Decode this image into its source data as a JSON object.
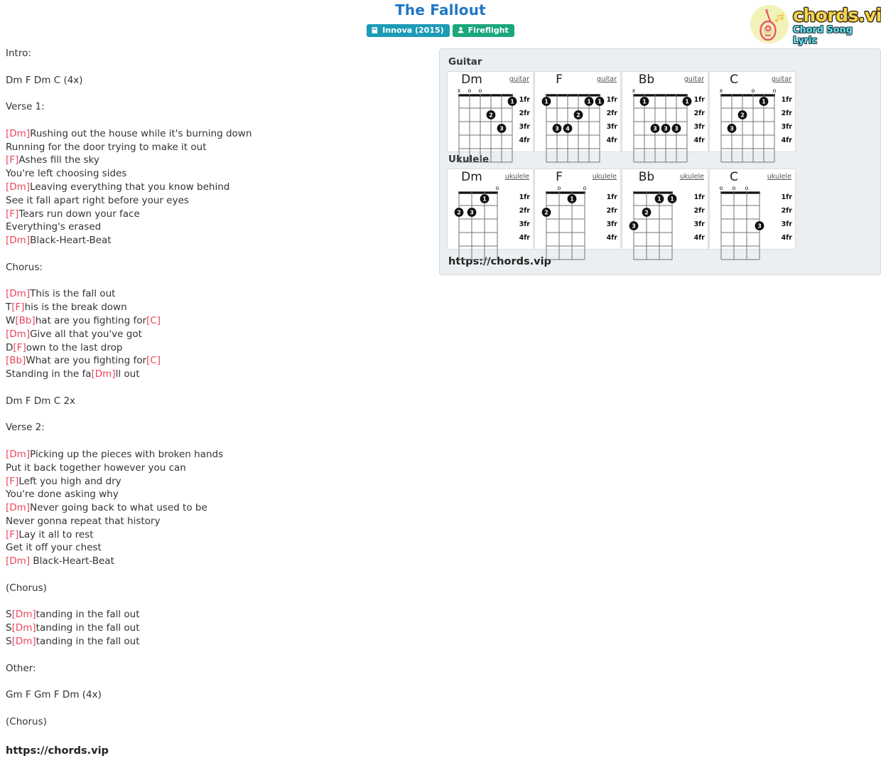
{
  "header": {
    "title": "The Fallout",
    "badges": [
      {
        "icon": "album-icon",
        "label": "Innova (2015)",
        "color": "#1b9bb5"
      },
      {
        "icon": "artist-icon",
        "label": "Fireflight",
        "color": "#1aa77b"
      }
    ]
  },
  "logo": {
    "main": "chords.vip",
    "sub": "Chord Song Lyric",
    "icon": "guitar-icon",
    "colors": {
      "circle": "#f2f2b8",
      "guitar": "#e8546a",
      "main": "#f7d34a",
      "sub": "#63e6f0"
    }
  },
  "lyrics": {
    "accent_color": "#e8475c",
    "blocks": [
      {
        "type": "text",
        "segments": [
          {
            "t": "Intro:"
          }
        ]
      },
      {
        "type": "blank"
      },
      {
        "type": "text",
        "segments": [
          {
            "t": "Dm F Dm C (4x)"
          }
        ]
      },
      {
        "type": "blank"
      },
      {
        "type": "text",
        "segments": [
          {
            "t": "Verse 1:"
          }
        ]
      },
      {
        "type": "blank"
      },
      {
        "type": "text",
        "segments": [
          {
            "c": "[Dm]"
          },
          {
            "t": "Rushing out the house while it's burning down"
          }
        ]
      },
      {
        "type": "text",
        "segments": [
          {
            "t": "Running for the door trying to make it out"
          }
        ]
      },
      {
        "type": "text",
        "segments": [
          {
            "c": "[F]"
          },
          {
            "t": "Ashes fill the sky"
          }
        ]
      },
      {
        "type": "text",
        "segments": [
          {
            "t": "You're left choosing sides"
          }
        ]
      },
      {
        "type": "text",
        "segments": [
          {
            "c": "[Dm]"
          },
          {
            "t": "Leaving everything that you know behind"
          }
        ]
      },
      {
        "type": "text",
        "segments": [
          {
            "t": "See it fall apart right before your eyes"
          }
        ]
      },
      {
        "type": "text",
        "segments": [
          {
            "c": "[F]"
          },
          {
            "t": "Tears run down your face"
          }
        ]
      },
      {
        "type": "text",
        "segments": [
          {
            "t": "Everything's erased"
          }
        ]
      },
      {
        "type": "text",
        "segments": [
          {
            "c": "[Dm]"
          },
          {
            "t": "Black-Heart-Beat"
          }
        ]
      },
      {
        "type": "blank"
      },
      {
        "type": "text",
        "segments": [
          {
            "t": "Chorus:"
          }
        ]
      },
      {
        "type": "blank"
      },
      {
        "type": "text",
        "segments": [
          {
            "c": "[Dm]"
          },
          {
            "t": "This is the fall out"
          }
        ]
      },
      {
        "type": "text",
        "segments": [
          {
            "t": "T"
          },
          {
            "c": "[F]"
          },
          {
            "t": "his is the break down"
          }
        ]
      },
      {
        "type": "text",
        "segments": [
          {
            "t": "W"
          },
          {
            "c": "[Bb]"
          },
          {
            "t": "hat are you fighting for"
          },
          {
            "c": "[C]"
          }
        ]
      },
      {
        "type": "text",
        "segments": [
          {
            "c": "[Dm]"
          },
          {
            "t": "Give all that you've got"
          }
        ]
      },
      {
        "type": "text",
        "segments": [
          {
            "t": "D"
          },
          {
            "c": "[F]"
          },
          {
            "t": "own to the last drop"
          }
        ]
      },
      {
        "type": "text",
        "segments": [
          {
            "c": "[Bb]"
          },
          {
            "t": "What are you fighting for"
          },
          {
            "c": "[C]"
          }
        ]
      },
      {
        "type": "text",
        "segments": [
          {
            "t": "Standing in the fa"
          },
          {
            "c": "[Dm]"
          },
          {
            "t": "ll out"
          }
        ]
      },
      {
        "type": "blank"
      },
      {
        "type": "text",
        "segments": [
          {
            "t": "Dm F Dm C 2x"
          }
        ]
      },
      {
        "type": "blank"
      },
      {
        "type": "text",
        "segments": [
          {
            "t": "Verse 2:"
          }
        ]
      },
      {
        "type": "blank"
      },
      {
        "type": "text",
        "segments": [
          {
            "c": "[Dm]"
          },
          {
            "t": "Picking up the pieces with broken hands"
          }
        ]
      },
      {
        "type": "text",
        "segments": [
          {
            "t": "Put it back together however you can"
          }
        ]
      },
      {
        "type": "text",
        "segments": [
          {
            "c": "[F]"
          },
          {
            "t": "Left you high and dry"
          }
        ]
      },
      {
        "type": "text",
        "segments": [
          {
            "t": "You're done asking why"
          }
        ]
      },
      {
        "type": "text",
        "segments": [
          {
            "c": "[Dm]"
          },
          {
            "t": "Never going back to what used to be"
          }
        ]
      },
      {
        "type": "text",
        "segments": [
          {
            "t": "Never gonna repeat that history"
          }
        ]
      },
      {
        "type": "text",
        "segments": [
          {
            "c": "[F]"
          },
          {
            "t": "Lay it all to rest"
          }
        ]
      },
      {
        "type": "text",
        "segments": [
          {
            "t": "Get it off your chest"
          }
        ]
      },
      {
        "type": "text",
        "segments": [
          {
            "c": "[Dm]"
          },
          {
            "t": " Black-Heart-Beat"
          }
        ]
      },
      {
        "type": "blank"
      },
      {
        "type": "text",
        "segments": [
          {
            "t": "(Chorus)"
          }
        ]
      },
      {
        "type": "blank"
      },
      {
        "type": "text",
        "segments": [
          {
            "t": "S"
          },
          {
            "c": "[Dm]"
          },
          {
            "t": "tanding in the fall out"
          }
        ]
      },
      {
        "type": "text",
        "segments": [
          {
            "t": "S"
          },
          {
            "c": "[Dm]"
          },
          {
            "t": "tanding in the fall out"
          }
        ]
      },
      {
        "type": "text",
        "segments": [
          {
            "t": "S"
          },
          {
            "c": "[Dm]"
          },
          {
            "t": "tanding in the fall out"
          }
        ]
      },
      {
        "type": "blank"
      },
      {
        "type": "text",
        "segments": [
          {
            "t": "Other:"
          }
        ]
      },
      {
        "type": "blank"
      },
      {
        "type": "text",
        "segments": [
          {
            "t": "Gm F Gm F Dm (4x)"
          }
        ]
      },
      {
        "type": "blank"
      },
      {
        "type": "text",
        "segments": [
          {
            "t": "(Chorus)"
          }
        ]
      },
      {
        "type": "blank"
      },
      {
        "type": "url",
        "segments": [
          {
            "t": "https://chords.vip"
          }
        ]
      }
    ]
  },
  "panel": {
    "url": "https://chords.vip",
    "fret_labels": [
      "1fr",
      "2fr",
      "3fr",
      "4fr"
    ],
    "sections": [
      {
        "heading": "Guitar",
        "instrument_label": "guitar",
        "strings": 6,
        "chords": [
          {
            "name": "Dm",
            "markers": [
              {
                "string": 1,
                "sym": "x"
              },
              {
                "string": 2,
                "sym": "o"
              },
              {
                "string": 3,
                "sym": "o"
              }
            ],
            "dots": [
              {
                "string": 6,
                "fret": 1,
                "finger": "1"
              },
              {
                "string": 4,
                "fret": 2,
                "finger": "2"
              },
              {
                "string": 5,
                "fret": 3,
                "finger": "3"
              }
            ]
          },
          {
            "name": "F",
            "markers": [],
            "dots": [
              {
                "string": 1,
                "fret": 1,
                "finger": "1"
              },
              {
                "string": 5,
                "fret": 1,
                "finger": "1"
              },
              {
                "string": 6,
                "fret": 1,
                "finger": "1"
              },
              {
                "string": 4,
                "fret": 2,
                "finger": "2"
              },
              {
                "string": 2,
                "fret": 3,
                "finger": "3"
              },
              {
                "string": 3,
                "fret": 3,
                "finger": "4"
              }
            ]
          },
          {
            "name": "Bb",
            "markers": [
              {
                "string": 1,
                "sym": "x"
              }
            ],
            "dots": [
              {
                "string": 2,
                "fret": 1,
                "finger": "1"
              },
              {
                "string": 6,
                "fret": 1,
                "finger": "1"
              },
              {
                "string": 3,
                "fret": 3,
                "finger": "3"
              },
              {
                "string": 4,
                "fret": 3,
                "finger": "3"
              },
              {
                "string": 5,
                "fret": 3,
                "finger": "3"
              }
            ]
          },
          {
            "name": "C",
            "markers": [
              {
                "string": 1,
                "sym": "x"
              },
              {
                "string": 4,
                "sym": "o"
              },
              {
                "string": 6,
                "sym": "o"
              }
            ],
            "dots": [
              {
                "string": 5,
                "fret": 1,
                "finger": "1"
              },
              {
                "string": 3,
                "fret": 2,
                "finger": "2"
              },
              {
                "string": 2,
                "fret": 3,
                "finger": "3"
              }
            ]
          }
        ]
      },
      {
        "heading": "Ukulele",
        "instrument_label": "ukulele",
        "strings": 4,
        "chords": [
          {
            "name": "Dm",
            "markers": [
              {
                "string": 4,
                "sym": "o"
              }
            ],
            "dots": [
              {
                "string": 3,
                "fret": 1,
                "finger": "1"
              },
              {
                "string": 1,
                "fret": 2,
                "finger": "2"
              },
              {
                "string": 2,
                "fret": 2,
                "finger": "3"
              }
            ]
          },
          {
            "name": "F",
            "markers": [
              {
                "string": 2,
                "sym": "o"
              },
              {
                "string": 4,
                "sym": "o"
              }
            ],
            "dots": [
              {
                "string": 3,
                "fret": 1,
                "finger": "1"
              },
              {
                "string": 1,
                "fret": 2,
                "finger": "2"
              }
            ]
          },
          {
            "name": "Bb",
            "markers": [],
            "dots": [
              {
                "string": 3,
                "fret": 1,
                "finger": "1"
              },
              {
                "string": 4,
                "fret": 1,
                "finger": "1"
              },
              {
                "string": 2,
                "fret": 2,
                "finger": "2"
              },
              {
                "string": 1,
                "fret": 3,
                "finger": "3"
              }
            ]
          },
          {
            "name": "C",
            "markers": [
              {
                "string": 1,
                "sym": "o"
              },
              {
                "string": 2,
                "sym": "o"
              },
              {
                "string": 3,
                "sym": "o"
              }
            ],
            "dots": [
              {
                "string": 4,
                "fret": 3,
                "finger": "3"
              }
            ]
          }
        ]
      }
    ]
  }
}
